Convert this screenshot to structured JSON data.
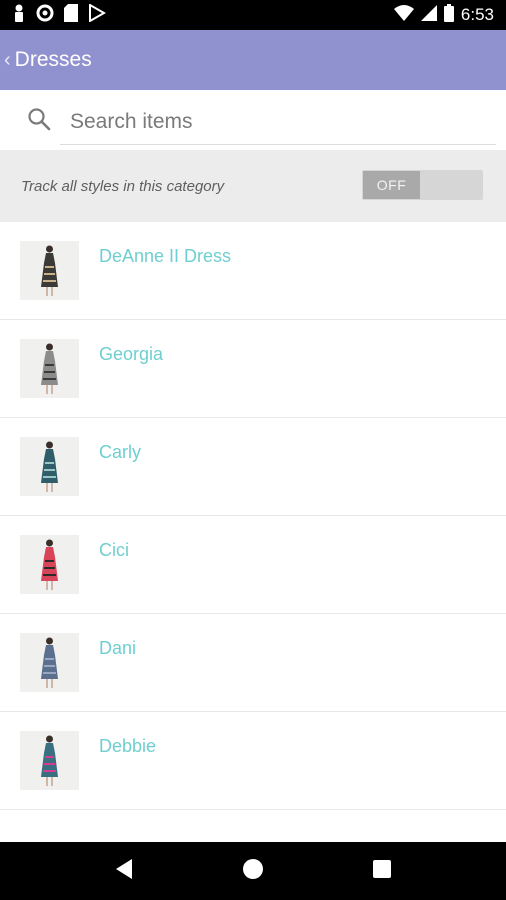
{
  "status_bar": {
    "time": "6:53"
  },
  "app_bar": {
    "title": "Dresses"
  },
  "search": {
    "placeholder": "Search items"
  },
  "track": {
    "label": "Track all styles in this category",
    "toggle_label": "OFF",
    "toggle_on": false
  },
  "items": [
    {
      "name": "DeAnne II Dress",
      "dress_color": "#3b3a36",
      "accent": "#c9b28a"
    },
    {
      "name": "Georgia",
      "dress_color": "#8c8c8c",
      "accent": "#3a3a3a"
    },
    {
      "name": "Carly",
      "dress_color": "#2f5e6a",
      "accent": "#9cc7c4"
    },
    {
      "name": "Cici",
      "dress_color": "#d8455a",
      "accent": "#2a2a2a"
    },
    {
      "name": "Dani",
      "dress_color": "#5b6f8f",
      "accent": "#9aa8bf"
    },
    {
      "name": "Debbie",
      "dress_color": "#3a6f82",
      "accent": "#d83c8e"
    }
  ],
  "icons": {
    "status": [
      "person-icon",
      "circle-icon",
      "sd-card-icon",
      "play-store-icon",
      "wifi-icon",
      "signal-icon",
      "battery-icon"
    ],
    "nav": [
      "back-triangle-icon",
      "home-circle-icon",
      "recents-square-icon"
    ]
  }
}
